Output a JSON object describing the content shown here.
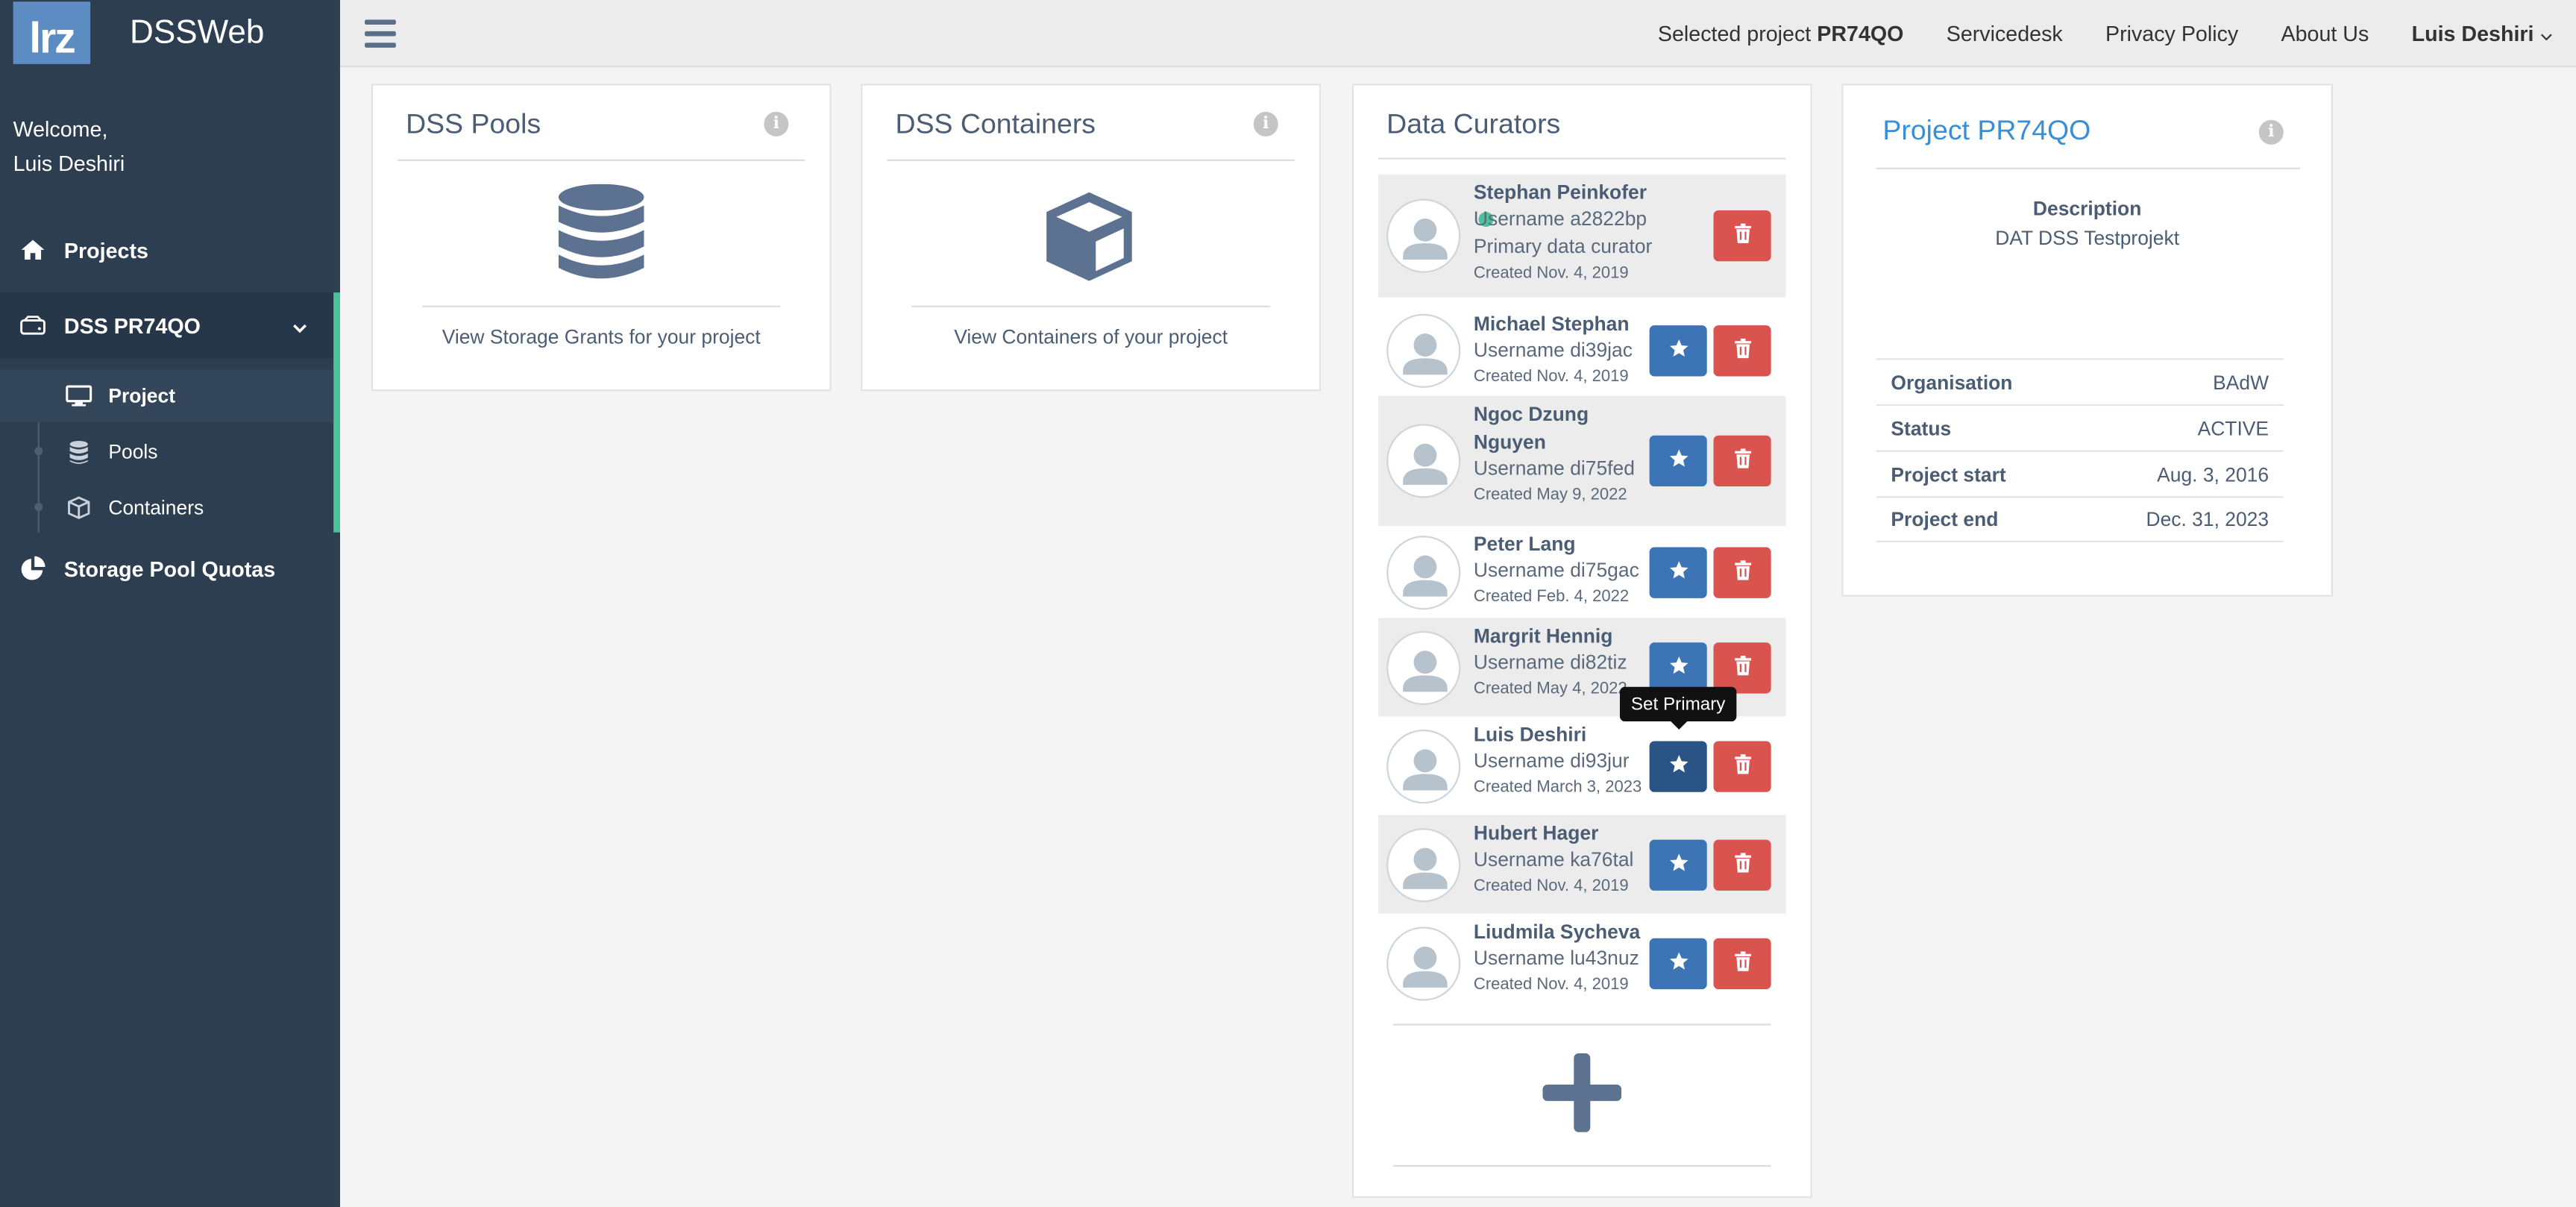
{
  "app": {
    "logo_text": "lrz",
    "title": "DSSWeb"
  },
  "sidebar": {
    "welcome": "Welcome,",
    "user": "Luis Deshiri",
    "items": [
      {
        "label": "Projects",
        "icon": "home-icon"
      },
      {
        "label": "DSS PR74QO",
        "icon": "drive-icon"
      },
      {
        "label": "Storage Pool Quotas",
        "icon": "pie-chart-icon"
      }
    ],
    "subitems": [
      {
        "label": "Project",
        "icon": "monitor-icon"
      },
      {
        "label": "Pools",
        "icon": "database-icon"
      },
      {
        "label": "Containers",
        "icon": "cube-icon"
      }
    ]
  },
  "topbar": {
    "selected_prefix": "Selected project",
    "selected_project": "PR74QO",
    "servicedesk": "Servicedesk",
    "privacy": "Privacy Policy",
    "about": "About Us",
    "user": "Luis Deshiri"
  },
  "pools_panel": {
    "title": "DSS Pools",
    "link": "View Storage Grants for your project"
  },
  "containers_panel": {
    "title": "DSS Containers",
    "link": "View Containers of your project"
  },
  "curators_panel": {
    "title": "Data Curators",
    "tooltip": "Set Primary",
    "curators": [
      {
        "name": "Stephan Peinkofer",
        "username": "Username a2822bp",
        "role": "Primary data curator",
        "created": "Created Nov. 4, 2019",
        "primary": true
      },
      {
        "name": "Michael Stephan",
        "username": "Username di39jac",
        "created": "Created Nov. 4, 2019"
      },
      {
        "name": "Ngoc Dzung Nguyen",
        "username": "Username di75fed",
        "created": "Created May 9, 2022"
      },
      {
        "name": "Peter Lang",
        "username": "Username di75gac",
        "created": "Created Feb. 4, 2022"
      },
      {
        "name": "Margrit Hennig",
        "username": "Username di82tiz",
        "created": "Created May 4, 2022"
      },
      {
        "name": "Luis Deshiri",
        "username": "Username di93jur",
        "created": "Created March 3, 2023"
      },
      {
        "name": "Hubert Hager",
        "username": "Username ka76tal",
        "created": "Created Nov. 4, 2019"
      },
      {
        "name": "Liudmila Sycheva",
        "username": "Username lu43nuz",
        "created": "Created Nov. 4, 2019"
      }
    ]
  },
  "project_panel": {
    "title": "Project PR74QO",
    "description_label": "Description",
    "description": "DAT DSS Testprojekt",
    "rows": [
      {
        "key": "Organisation",
        "value": "BAdW"
      },
      {
        "key": "Status",
        "value": "ACTIVE"
      },
      {
        "key": "Project start",
        "value": "Aug. 3, 2016"
      },
      {
        "key": "Project end",
        "value": "Dec. 31, 2023"
      }
    ]
  },
  "colors": {
    "sidebar": "#2d3e50",
    "accent": "#4cc29a",
    "primary_button": "#3d74b5",
    "danger_button": "#d9534f",
    "link": "#3a8fd4"
  }
}
